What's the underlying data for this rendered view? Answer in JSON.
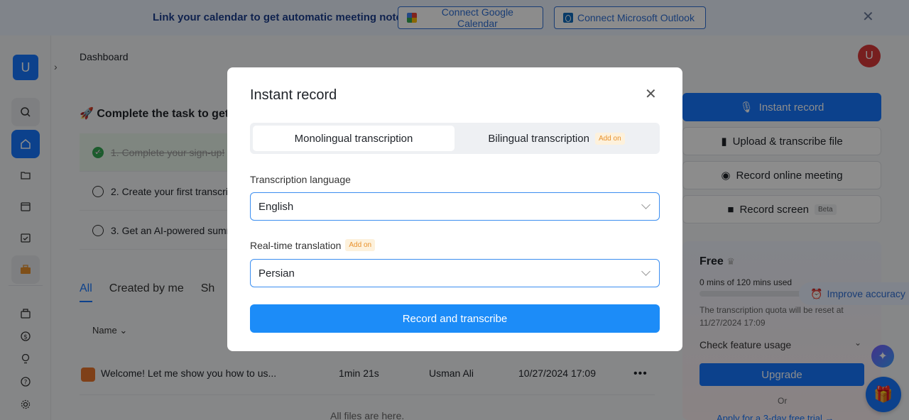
{
  "banner": {
    "text": "Link your calendar to get automatic meeting notes",
    "google_label": "Connect Google Calendar",
    "outlook_label": "Connect Microsoft Outlook"
  },
  "sidebar": {
    "logo_letter": "U"
  },
  "header": {
    "breadcrumb": "Dashboard",
    "avatar_letter": "U"
  },
  "tasks": {
    "title": "Complete the task to get",
    "items": [
      {
        "label": "1. Complete your sign-up!",
        "done": true
      },
      {
        "label": "2. Create your first transcri",
        "done": false
      },
      {
        "label": "3. Get an AI-powered summ",
        "done": false
      }
    ]
  },
  "tabs": [
    "All",
    "Created by me",
    "Sh"
  ],
  "table": {
    "name_header": "Name",
    "rows": [
      {
        "name": "Welcome! Let me show you how to us...",
        "duration": "1min 21s",
        "owner": "Usman Ali",
        "date": "10/27/2024 17:09"
      }
    ],
    "footer": "All files are here."
  },
  "actions": {
    "instant_record": "Instant record",
    "upload": "Upload & transcribe file",
    "online_meeting": "Record online meeting",
    "record_screen": "Record screen",
    "beta": "Beta"
  },
  "plan": {
    "name": "Free",
    "usage": "0 mins of 120 mins used",
    "usage_fraction": 0,
    "reset_text": "The transcription quota will be reset at 11/27/2024 17:09",
    "check_usage": "Check feature usage",
    "upgrade": "Upgrade",
    "or": "Or",
    "trial": "Apply for a 3-day free trial →"
  },
  "improve_accuracy": "Improve accuracy",
  "modal": {
    "title": "Instant record",
    "tab_mono": "Monolingual transcription",
    "tab_bi": "Bilingual transcription",
    "add_on": "Add on",
    "language_label": "Transcription language",
    "language_value": "English",
    "translation_label": "Real-time translation",
    "translation_value": "Persian",
    "submit": "Record and transcribe"
  }
}
